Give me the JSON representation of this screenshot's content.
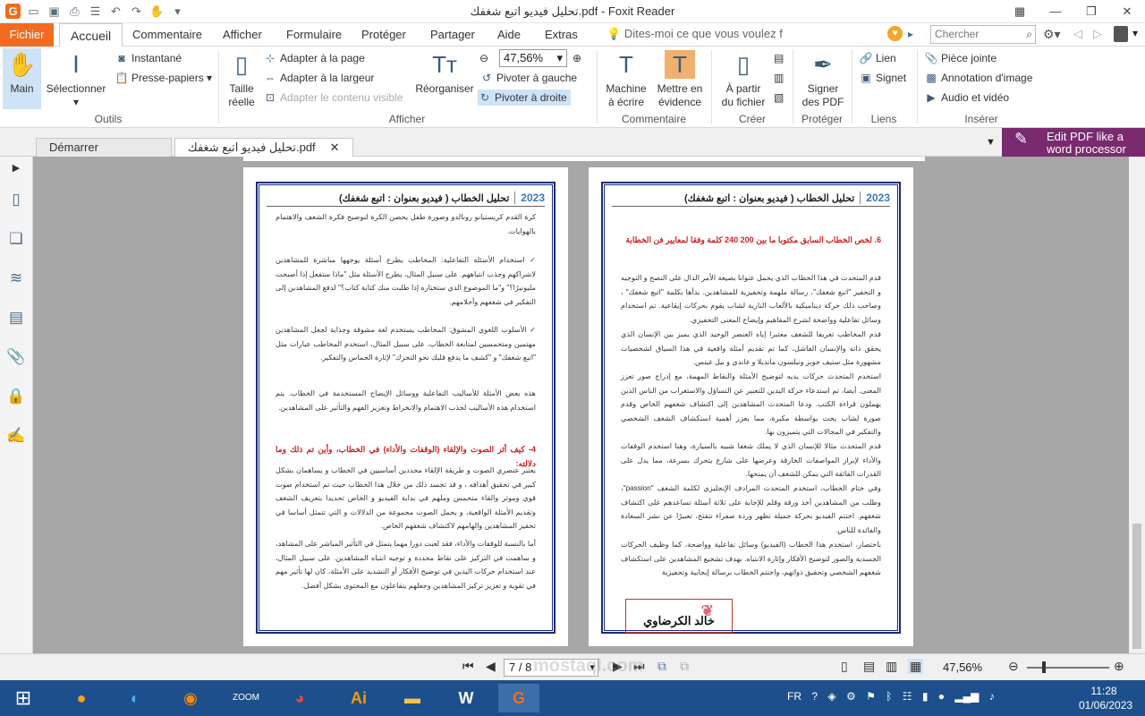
{
  "window": {
    "title": "تحليل فيديو اتبع شغفك.pdf - Foxit Reader"
  },
  "ribbon_tabs": {
    "fichier": "Fichier",
    "accueil": "Accueil",
    "commentaire": "Commentaire",
    "afficher": "Afficher",
    "formulaire": "Formulaire",
    "proteger": "Protéger",
    "partager": "Partager",
    "aide": "Aide",
    "extras": "Extras"
  },
  "tell_me": "Dites-moi ce que vous voulez f",
  "search": {
    "placeholder": "Chercher"
  },
  "tools": {
    "main": "Main",
    "selectionner": "Sélectionner",
    "instantane": "Instantané",
    "presse": "Presse-papiers",
    "group": "Outils"
  },
  "afficher": {
    "taille": "Taille",
    "reelle": "réelle",
    "page": "Adapter à la page",
    "largeur": "Adapter à la largeur",
    "contenu": "Adapter le contenu visible",
    "reorg": "Réorganiser",
    "zoom": "47,56%",
    "gauche": "Pivoter à gauche",
    "droite": "Pivoter à droite",
    "group": "Afficher"
  },
  "commentaire": {
    "machine1": "Machine",
    "machine2": "à écrire",
    "mettre1": "Mettre en",
    "mettre2": "évidence",
    "group": "Commentaire"
  },
  "creer": {
    "a1": "À partir",
    "a2": "du fichier",
    "group": "Créer"
  },
  "proteger": {
    "s1": "Signer",
    "s2": "des PDF",
    "group": "Protéger"
  },
  "liens": {
    "lien": "Lien",
    "signet": "Signet",
    "group": "Liens"
  },
  "inserer": {
    "piece": "Pièce jointe",
    "annotation": "Annotation d'image",
    "audio": "Audio et vidéo",
    "group": "Insérer"
  },
  "doc_tabs": {
    "demarrer": "Démarrer",
    "current": "تحليل فيديو اتبع شغفك.pdf"
  },
  "promo": {
    "line1": "Edit PDF like a",
    "line2": "word processor"
  },
  "left_page": {
    "header_title": "تحليل الخطاب ( فيديو بعنوان : اتبع شغفك)",
    "header_year": "2023",
    "p1": "كرة القدم كريستيانو رونالدو وصورة طفل يحضن الكرة لتوضيح فكرة الشغف والاهتمام بالهوايات.",
    "p2": "✓ استخدام الأسئلة التفاعلية: المخاطب يطرح أسئلة يوجهها مباشرة للمشاهدين لاشراكهم وجذب انتباههم. على سبيل المثال، يطرح الأسئلة مثل \"ماذا ستفعل إذا أصبحت مليونيرًا؟\" و\"ما الموضوع الذي ستختاره إذا طلبت منك كتابة كتاب؟\" لدفع المشاهدين إلى التفكير في شغفهم وأحلامهم.",
    "p3": "✓ الأسلوب اللغوي المشوق: المخاطب يستخدم لغة مشوقة وجذابة لجعل المشاهدين مهتمين ومتحمسين لمتابعة الخطاب. على سبيل المثال، استخدم المخاطب عبارات مثل \"اتبع شغفك\" و \"كشف ما يدفع قلبك نحو التحرك\" لإثارة الحماس والتفكير.",
    "p4": "هذه بعض الأمثلة للأساليب التفاعلية ووسائل الإيضاح المستخدمة في الخطاب. يتم استخدام هذه الأساليب لجذب الاهتمام والانخراط وتعزيز الفهم والتأثير على المشاهدين.",
    "h4": "4- كيف أثر الصوت والإلقاء (الوقفات والأداء) في الخطاب، وأين تم ذلك وما دلالته:",
    "p5": "يعتبر عنصري الصوت و طريقة الإلقاء محددين أساسيين في الخطاب و يساهمان بشكل كبير في تحقيق أهدافه ، و قد تجسد ذلك من خلال هذا الخطاب حيث تم استخدام صوت قوي وموثر والقاء متحمس وملهم في بداية الفيديو و الخاص تحديدا بتعريف الشغف وتقديم الأمثلة الواقعية، و يحمل الصوت مجموعة من الدلالات و التي تتمثل أساسا في تحفيز المشاهدين والهامهم لاكتشاف شغفهم الخاص.",
    "p6": "أما بالنسبة للوقفات والأداء، فقد لعبت دورا مهما يتمثل في التأثير المباشر على المشاهد، و ساهمت في التركيز على نقاط محددة و توجيه انتباه المشاهدين. على سبيل المثال، عند استخدام حركات اليدين في توضيح الأفكار أو التشديد على الأمثلة، كان لها تأثير مهم في تقوية و تعزيز تركيز المشاهدين وجعلهم يتفاعلون مع المحتوى بشكل أفضل."
  },
  "right_page": {
    "header_title": "تحليل الخطاب ( فيديو بعنوان : اتبع شغفك)",
    "header_year": "2023",
    "h6": "6. لخص الخطاب السابق مكتوبا ما بين 200 240 كلمة وفقا لمعايير فن الخطابة",
    "p1": "قدم المتحدث في هذا الخطاب الذي يحمل عنوانا بصيغة الأمر الدال على النصح و التوجيه و التحفيز \"اتبع شغفك\"، رسالة ملهمة وتحفيزية للمشاهدين. بدأها بكلمة \"اتبع شغفك\" ، وصاحب ذلك حركة ديناميكية بالألعاب النارية لشاب يقوم بحركات إيقاعية. تم استخدام وسائل تفاعلية وواضحة لشرح المفاهيم وإيضاح المعنى التحفيزي.",
    "p2": "قدم المخاطب تعريفا للشغف معتبرا إياه العنصر الوحيد الذي يميز بين الإنسان الذي يحقق ذاته والإنسان الفاشل، كما تم تقديم أمثلة واقعية في هذا السياق لشخصيات مشهورة مثل ستيف جوبز ونيلسون مانديلا و غاندي و بيل غيتس.",
    "p3": "استخدم المتحدث حركات يديه لتوضيح الأمثلة والنقاط المهمة، مع إدراج صور تعزز المعنى. أيضا، تم استدعاء حركة اليدين للتعبير عن التساؤل والاستغراب من الناس الذين يهملون قراءة الكتب. ودعا المتحدث المشاهدين إلى اكتشاف شغفهم الخاص وقدم صورة لشاب يحث بواسطة مكبرة، مما يعزز أهمية استكشاف الشغف الشخصي والتفكير في المجالات التي يتميزون بها.",
    "p4": "قدم المتحدث مثالا للإنسان الذي لا يملك شغفا شبيه بالسيارة، وهنا استخدم الوقفات والأداء لإبراز المواصفات الخارقة وعرضها على شارع يتحرك بسرعة، مما يدل على القدرات الفائقة التي يمكن للشغف أن يمنحها.",
    "p5": "وفي ختام الخطاب، استخدم المتحدث المرادف الإنجليزي لكلمة الشغف \"passion\"، وطلب من المشاهدين أخذ ورقة وقلم للإجابة على ثلاثة أسئلة تساعدهم على اكتشاف شغفهم. اختتم الفيديو بحركة جميلة تظهر وردة صفراء تتفتح، تعبيرًا عن نشر السعادة والفائدة للناس.",
    "p6": "باختصار، استخدم هذا الخطاب (الفيديو) وسائل تفاعلية وواضحة، كما وظيف الحركات الجسدية والصور لتوضيح الأفكار وإثارة الانتباه. بهدف تشجيع المشاهدين على استكشاف شغفهم الشخصي وتحقيق ذواتهم، واختتم الخطاب برسالة إيجابية وتحفيزية",
    "signature": "خالد الكرضاوي"
  },
  "status": {
    "page": "7 / 8",
    "zoom": "47,56%"
  },
  "watermark": "mostaql.com",
  "tray": {
    "lang": "FR"
  },
  "clock": {
    "time": "11:28",
    "date": "01/06/2023"
  }
}
